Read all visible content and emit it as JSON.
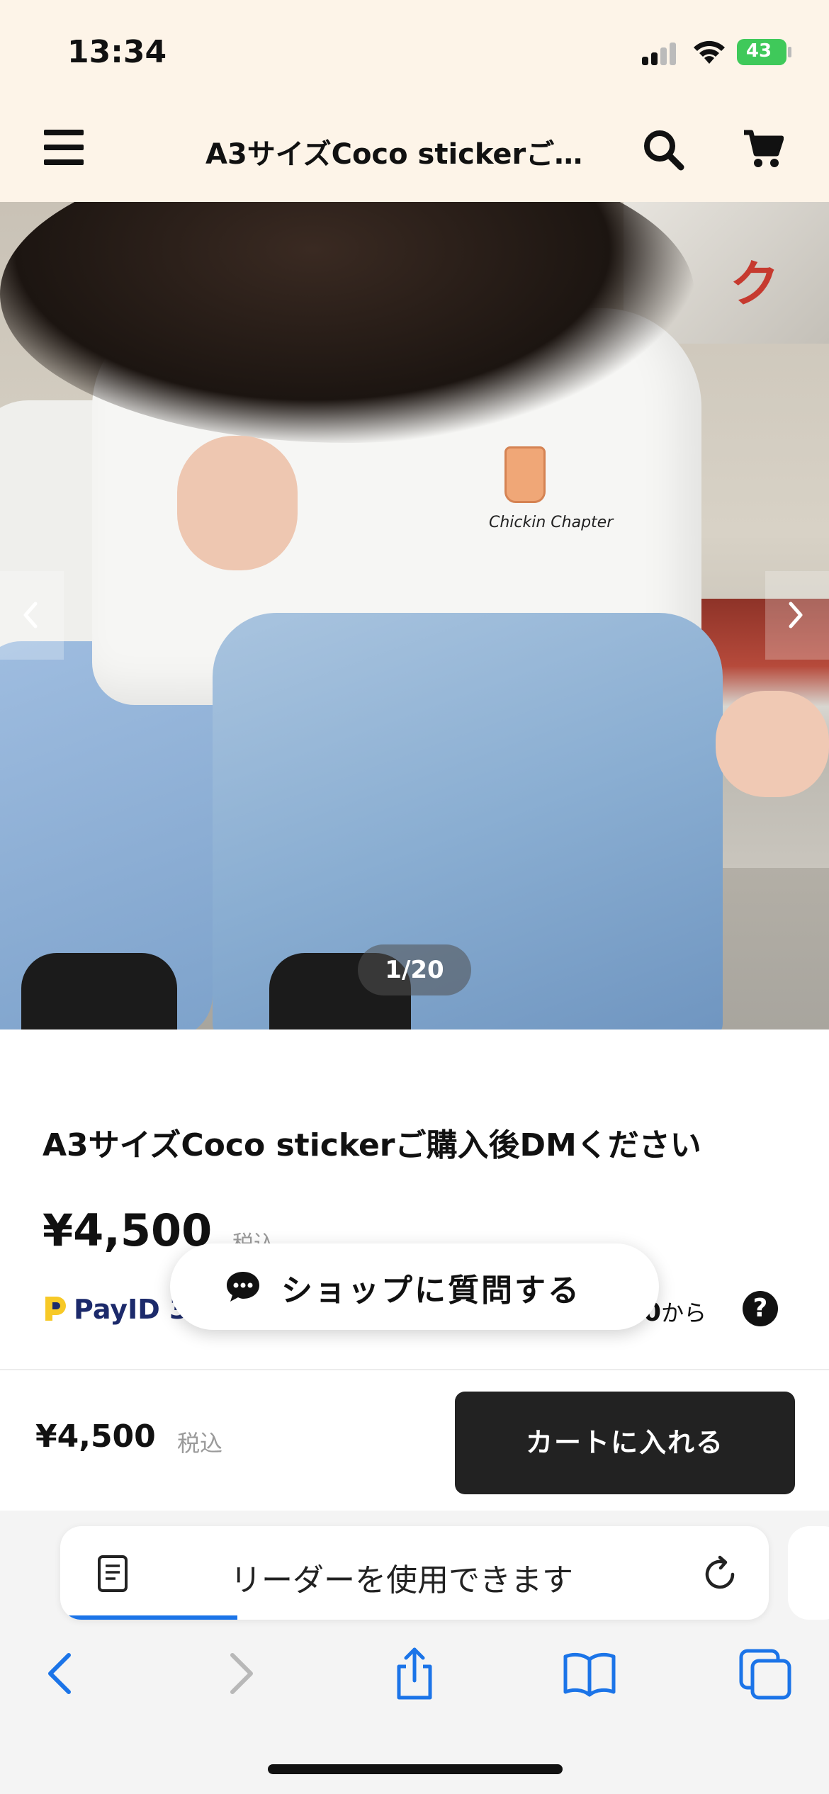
{
  "status_bar": {
    "time": "13:34",
    "battery_level": "43",
    "battery_color": "#3fc95a"
  },
  "header": {
    "title": "A3サイズCoco stickerご…",
    "background": "#fdf4e8",
    "icons": [
      "menu-icon",
      "search-icon",
      "cart-icon"
    ]
  },
  "gallery": {
    "counter": "1/20",
    "current_index": 1,
    "total": 20,
    "cup_print_text": "Chickin Chapter"
  },
  "product": {
    "title": "A3サイズCoco stickerご購入後DMください",
    "price": "¥4,500",
    "tax_label": "税込",
    "payid_text": "PayID 3",
    "payid_amount_tail": "0",
    "payid_suffix": "から",
    "help_symbol": "?"
  },
  "question_button": {
    "label": "ショップに質問する"
  },
  "purchase_bar": {
    "price": "¥4,500",
    "tax_label": "税込",
    "cart_button_label": "カートに入れる",
    "button_color": "#222222"
  },
  "safari": {
    "address_text": "リーダーを使用できます",
    "load_progress": 0.25,
    "accent_color": "#1b74e8",
    "toolbar": [
      "back-icon",
      "forward-icon",
      "share-icon",
      "bookmarks-icon",
      "tabs-icon"
    ]
  }
}
